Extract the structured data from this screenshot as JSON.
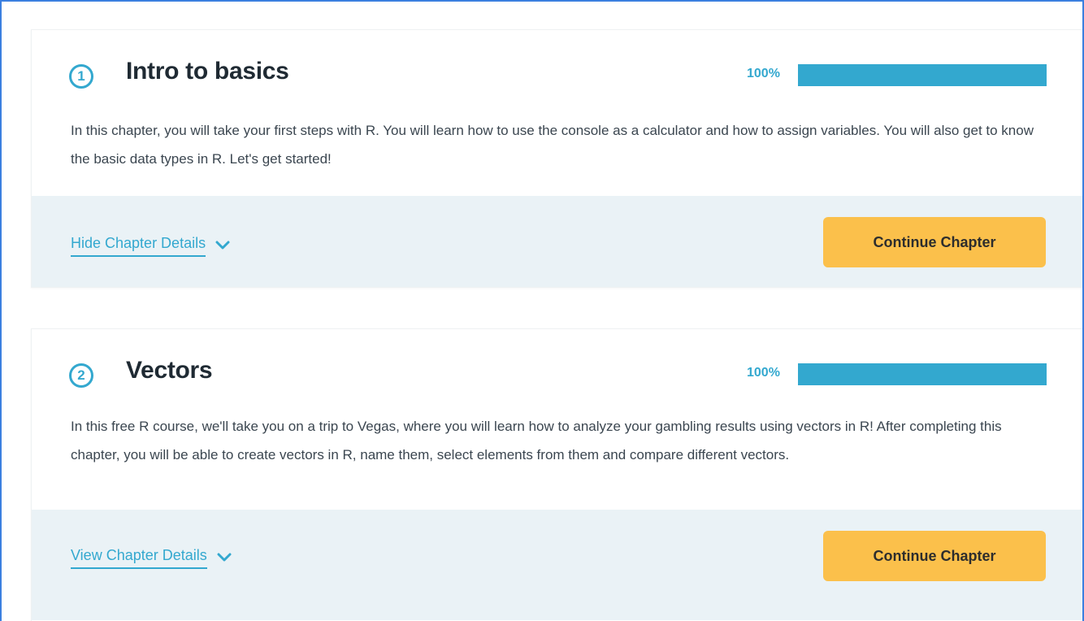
{
  "chapters": [
    {
      "number": "1",
      "title": "Intro to basics",
      "progress_label": "100%",
      "progress_fraction": 1.0,
      "description": "In this chapter, you will take your first steps with R. You will learn how to use the console as a calculator and how to assign variables. You will also get to know the basic data types in R. Let's get started!",
      "details_toggle": "Hide Chapter Details",
      "continue_label": "Continue Chapter"
    },
    {
      "number": "2",
      "title": "Vectors",
      "progress_label": "100%",
      "progress_fraction": 1.0,
      "description": "In this free R course, we'll take you on a trip to Vegas, where you will learn how to analyze your gambling results using vectors in R! After completing this chapter, you will be able to create vectors in R, name them, select elements from them and compare different vectors.",
      "details_toggle": "View Chapter Details",
      "continue_label": "Continue Chapter"
    }
  ],
  "colors": {
    "accent": "#33a8cf",
    "button": "#fbc04b",
    "footer_bg": "#eaf2f6",
    "frame_border": "#3b7fe0"
  },
  "icons": {
    "toggle": "chevron-down-icon"
  }
}
